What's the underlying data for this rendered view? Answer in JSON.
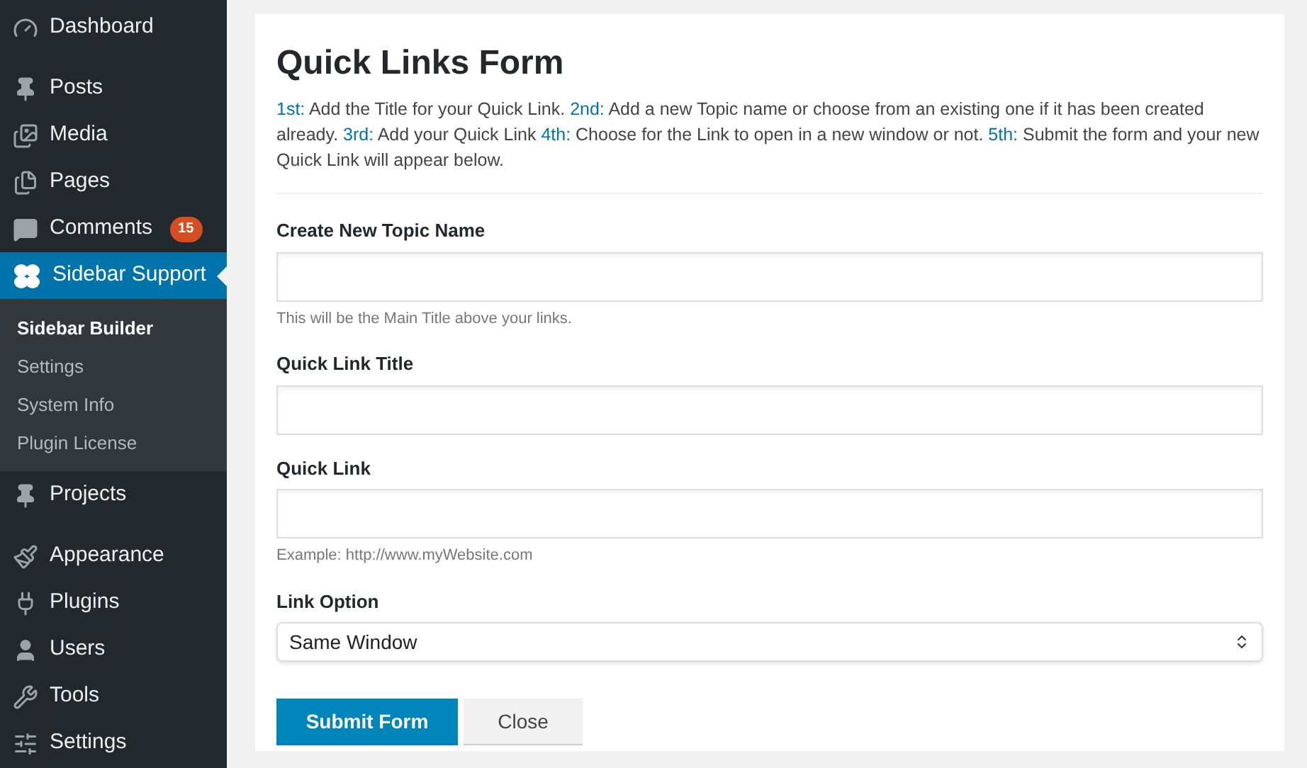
{
  "sidebar": {
    "items": [
      {
        "label": "Dashboard",
        "kind": "dashboard",
        "selected": false
      },
      {
        "label": "Posts",
        "kind": "pin",
        "selected": false
      },
      {
        "label": "Media",
        "kind": "media",
        "selected": false
      },
      {
        "label": "Pages",
        "kind": "pages",
        "selected": false
      },
      {
        "label": "Comments",
        "kind": "comments",
        "selected": false,
        "badge": "15"
      },
      {
        "label": "Sidebar Support",
        "kind": "clover",
        "selected": true,
        "children": [
          {
            "label": "Sidebar Builder",
            "selected": true
          },
          {
            "label": "Settings",
            "selected": false
          },
          {
            "label": "System Info",
            "selected": false
          },
          {
            "label": "Plugin License",
            "selected": false
          }
        ]
      },
      {
        "label": "Projects",
        "kind": "pin",
        "selected": false
      },
      {
        "label": "Appearance",
        "kind": "brush",
        "selected": false
      },
      {
        "label": "Plugins",
        "kind": "plug",
        "selected": false
      },
      {
        "label": "Users",
        "kind": "user",
        "selected": false
      },
      {
        "label": "Tools",
        "kind": "wrench",
        "selected": false
      },
      {
        "label": "Settings",
        "kind": "settings",
        "selected": false
      }
    ]
  },
  "form": {
    "title": "Quick Links Form",
    "intro": [
      {
        "kind": "step",
        "text": "1st:"
      },
      {
        "kind": "text",
        "text": " Add the Title for your Quick Link. "
      },
      {
        "kind": "step",
        "text": "2nd:"
      },
      {
        "kind": "text",
        "text": " Add a new Topic name or choose from an existing one if it has been created already. "
      },
      {
        "kind": "step",
        "text": "3rd:"
      },
      {
        "kind": "text",
        "text": " Add your Quick Link "
      },
      {
        "kind": "step",
        "text": "4th:"
      },
      {
        "kind": "text",
        "text": " Choose for the Link to open in a new window or not. "
      },
      {
        "kind": "step",
        "text": "5th:"
      },
      {
        "kind": "text",
        "text": " Submit the form and your new Quick Link will appear below."
      }
    ],
    "fields": [
      {
        "kind": "text",
        "label": "Create New Topic Name",
        "hint": "This will be the Main Title above your links."
      },
      {
        "kind": "text",
        "label": "Quick Link Title"
      },
      {
        "kind": "text",
        "label": "Quick Link",
        "hint": "Example: http://www.myWebsite.com"
      },
      {
        "kind": "select",
        "label": "Link Option",
        "value": "Same Window"
      }
    ],
    "buttons": [
      {
        "label": "Submit Form",
        "kind": "primary"
      },
      {
        "label": "Close",
        "kind": "secondary"
      }
    ]
  }
}
